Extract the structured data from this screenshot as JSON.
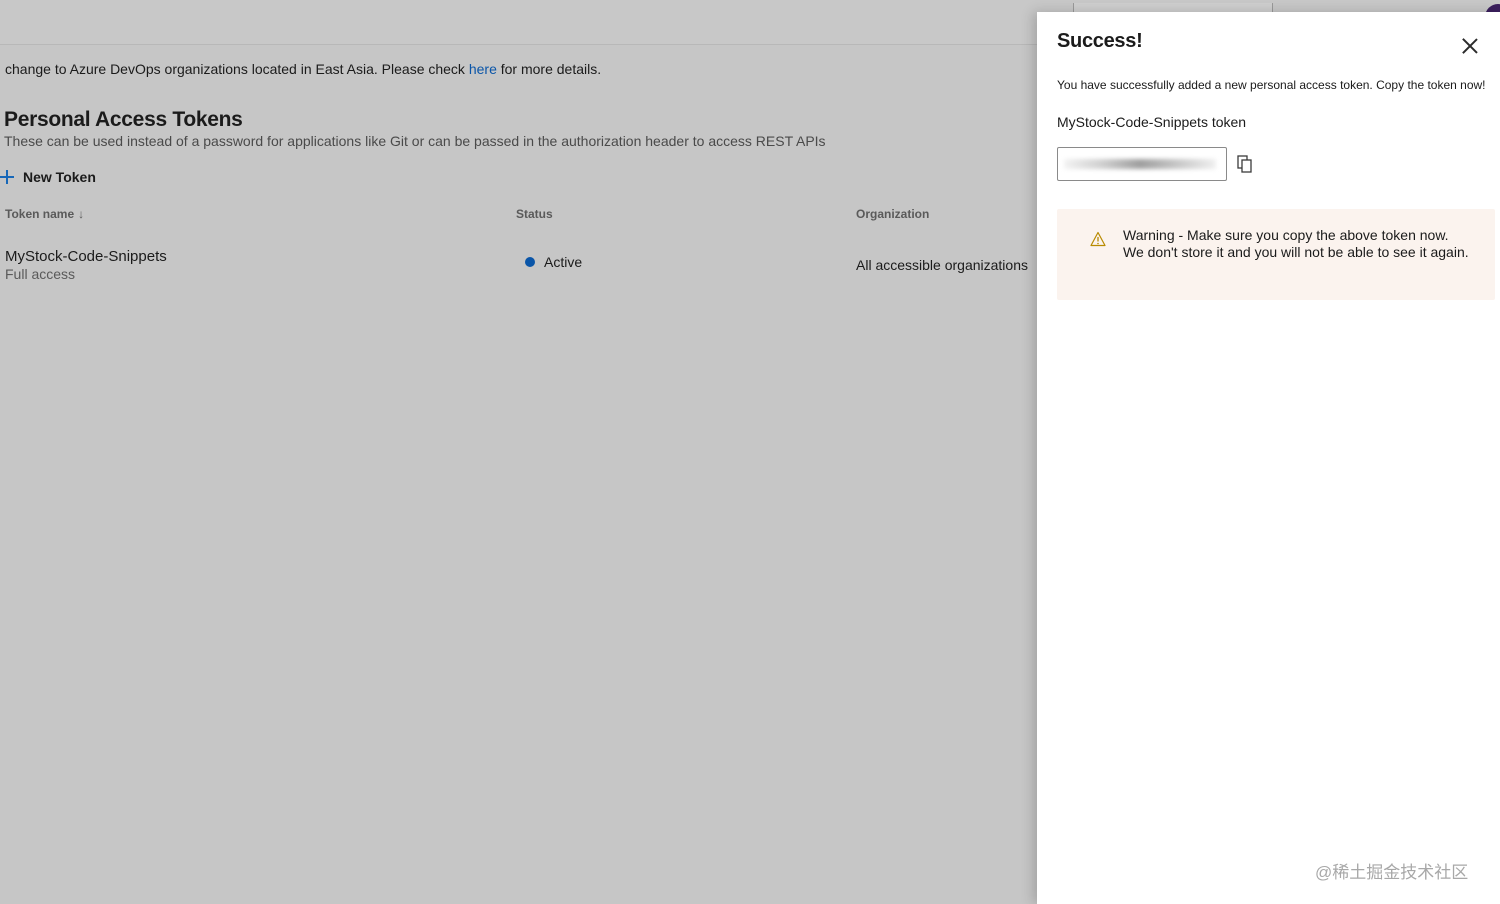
{
  "banner": {
    "text_before": "change to Azure DevOps organizations located in East Asia. Please check ",
    "link": "here",
    "text_after": " for more details."
  },
  "page": {
    "title": "Personal Access Tokens",
    "description": "These can be used instead of a password for applications like Git or can be passed in the authorization header to access REST APIs",
    "new_token_label": "New Token"
  },
  "table": {
    "columns": [
      "Token name",
      "Status",
      "Organization"
    ],
    "sort_icon": "↓",
    "rows": [
      {
        "name": "MyStock-Code-Snippets",
        "access": "Full access",
        "status": "Active",
        "organization": "All accessible organizations"
      }
    ]
  },
  "panel": {
    "title": "Success!",
    "message": "You have successfully added a new personal access token. Copy the token now!",
    "token_label": "MyStock-Code-Snippets token",
    "warning": "Warning - Make sure you copy the above token now. We don't store it and you will not be able to see it again."
  },
  "watermark": "@稀土掘金技术社区",
  "icons": {
    "close": "close-icon",
    "copy": "copy-icon",
    "warning": "warning-icon",
    "plus": "plus-icon",
    "status": "status-dot"
  },
  "colors": {
    "link": "#0a55a8",
    "accent": "#1767b8",
    "active_status": "#0a55a8",
    "warning_bg": "#fbf3ee",
    "warning_icon": "#b88a00"
  }
}
